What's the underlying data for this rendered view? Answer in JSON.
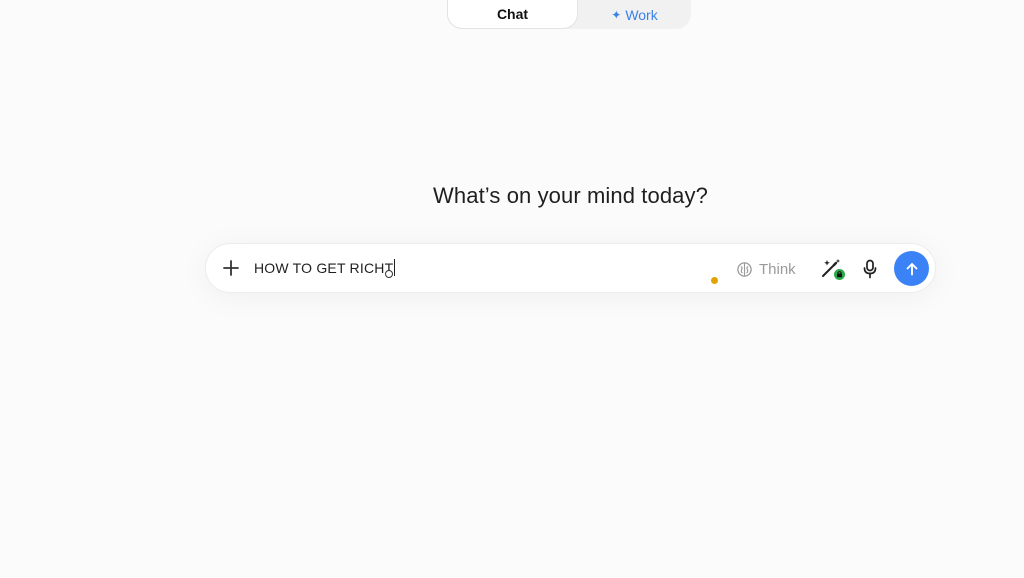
{
  "mode_toggle": {
    "chat_label": "Chat",
    "work_label": "Work",
    "work_icon": "sparkle-icon",
    "active": "Chat"
  },
  "heading": "What’s on your mind today?",
  "prompt": {
    "value": "HOW TO GET RICHT",
    "add_icon": "plus-icon",
    "think_label": "Think",
    "think_icon": "brain-icon",
    "tools_icon": "magic-wand-icon",
    "mic_icon": "microphone-icon",
    "send_icon": "arrow-up-icon"
  },
  "colors": {
    "accent": "#3b82f6",
    "work_text": "#3b82e8",
    "status_dot": "#e0a400",
    "badge_green": "#2eaa4a",
    "background": "#fbfbfb"
  }
}
